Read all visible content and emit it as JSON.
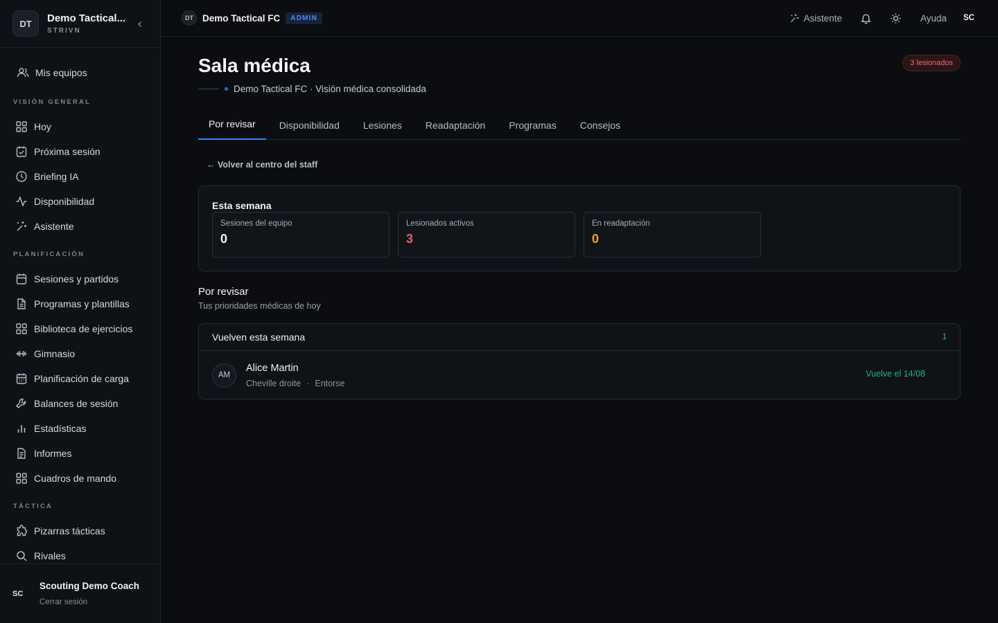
{
  "sidebar": {
    "logo": "DT",
    "team_name": "Demo Tactical...",
    "team_sub": "STRIVN",
    "mis_equipos": "Mis equipos",
    "sections": [
      {
        "label": "VISIÓN GENERAL"
      },
      {
        "label": "PLANIFICACIÓN"
      },
      {
        "label": "TÁCTICA"
      }
    ],
    "items": [
      {
        "label": "Hoy",
        "icon": "grid-icon"
      },
      {
        "label": "Próxima sesión",
        "icon": "calendar-check-icon"
      },
      {
        "label": "Briefing IA",
        "icon": "clock-icon"
      },
      {
        "label": "Disponibilidad",
        "icon": "activity-icon"
      },
      {
        "label": "Asistente",
        "icon": "sparkles-icon"
      },
      {
        "label": "Sesiones y partidos",
        "icon": "calendar-icon"
      },
      {
        "label": "Programas y plantillas",
        "icon": "file-icon"
      },
      {
        "label": "Biblioteca de ejercicios",
        "icon": "grid-icon"
      },
      {
        "label": "Gimnasio",
        "icon": "dumbbell-icon"
      },
      {
        "label": "Planificación de carga",
        "icon": "calendar-grid-icon"
      },
      {
        "label": "Balances de sesión",
        "icon": "wrench-icon"
      },
      {
        "label": "Estadísticas",
        "icon": "bar-chart-icon"
      },
      {
        "label": "Informes",
        "icon": "file-text-icon"
      },
      {
        "label": "Cuadros de mando",
        "icon": "grid-icon"
      },
      {
        "label": "Pizarras tácticas",
        "icon": "puzzle-icon"
      },
      {
        "label": "Rivales",
        "icon": "search-icon"
      }
    ],
    "user_initials": "SC",
    "user_name": "Scouting Demo Coach",
    "logout": "Cerrar sesión"
  },
  "topbar": {
    "logo": "DT",
    "team": "Demo Tactical FC",
    "badge": "ADMIN",
    "assistant": "Asistente",
    "help": "Ayuda",
    "me": "SC"
  },
  "page": {
    "title": "Sala médica",
    "pill": "3 lesionados",
    "subtitle": "Demo Tactical FC · Visión médica consolidada",
    "tabs": [
      "Por revisar",
      "Disponibilidad",
      "Lesiones",
      "Readaptación",
      "Programas",
      "Consejos"
    ],
    "active_tab": "Por revisar",
    "back": "← Volver al centro del staff",
    "week": {
      "title": "Esta semana",
      "stats": [
        {
          "label": "Sesiones del equipo",
          "value": "0",
          "color": "#f2f3f5"
        },
        {
          "label": "Lesionados activos",
          "value": "3",
          "color": "#ef5a63"
        },
        {
          "label": "En readaptación",
          "value": "0",
          "color": "#f2a31b"
        }
      ]
    },
    "review": {
      "title": "Por revisar",
      "subtitle": "Tus prioridades médicas de hoy",
      "list_title": "Vuelven esta semana",
      "count": "1",
      "rows": [
        {
          "initials": "AM",
          "name": "Alice Martin",
          "area": "Cheville droite",
          "type": "Entorse",
          "status": "Vuelve el 14/08"
        }
      ]
    }
  }
}
